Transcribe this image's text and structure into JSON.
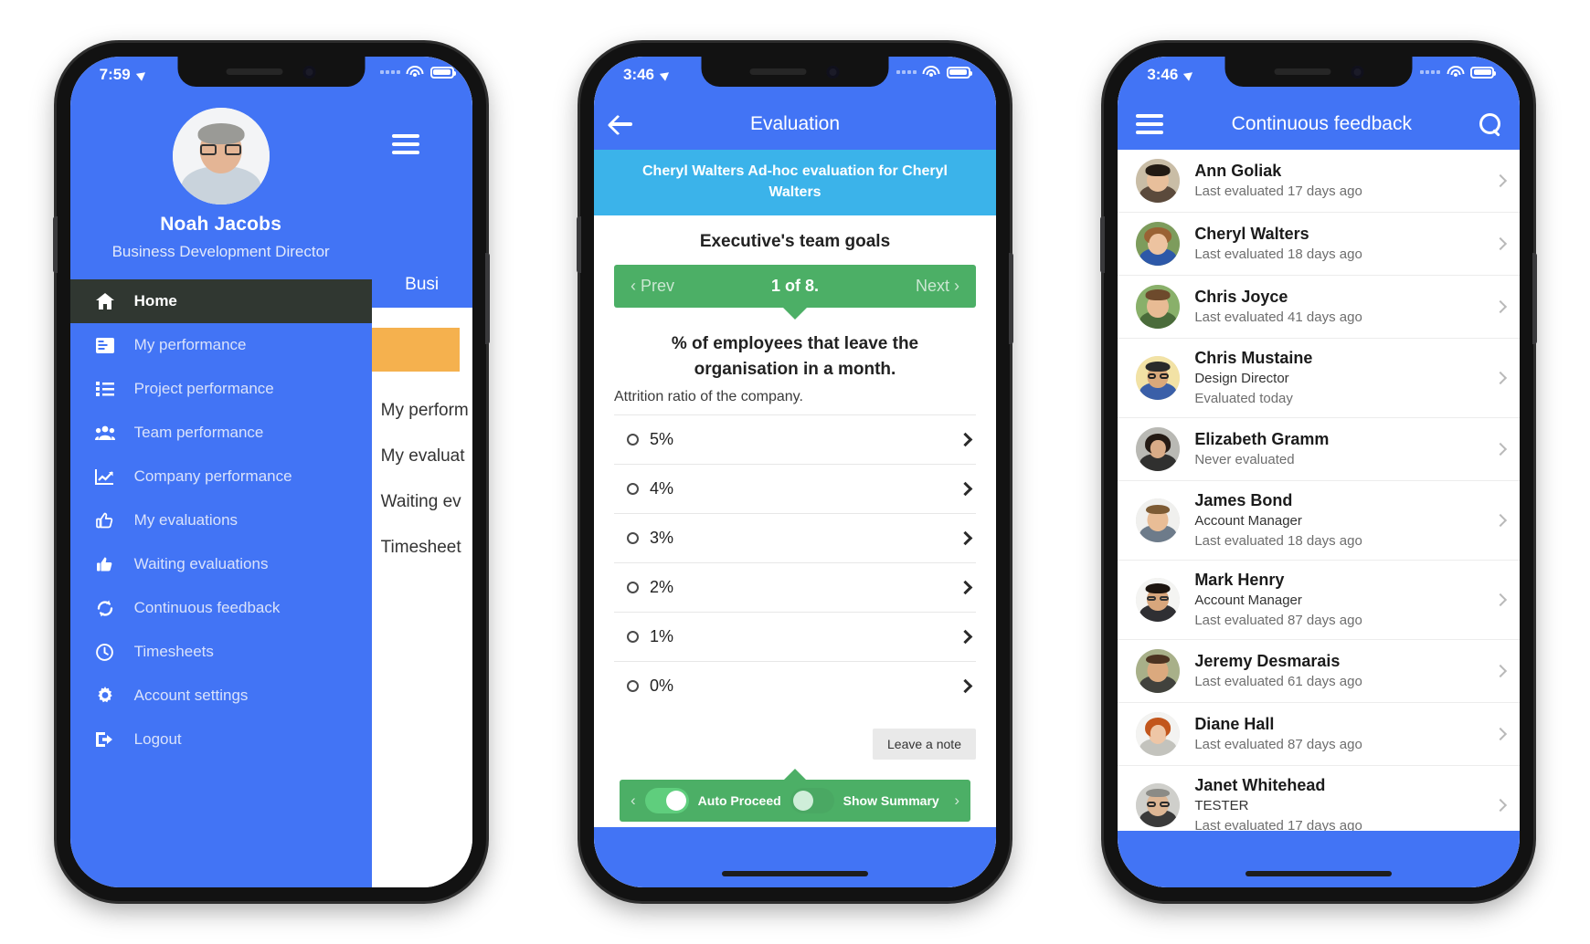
{
  "phone1": {
    "statusbar": {
      "time": "7:59",
      "location_icon": "location-arrow-icon",
      "wifi_icon": "wifi-icon",
      "battery_icon": "battery-icon"
    },
    "profile": {
      "name": "Noah Jacobs",
      "role": "Business Development Director",
      "avatar": "user-avatar"
    },
    "menu": [
      {
        "label": "Home",
        "icon": "home-icon",
        "active": true
      },
      {
        "label": "My performance",
        "icon": "dashboard-icon",
        "active": false
      },
      {
        "label": "Project performance",
        "icon": "list-icon",
        "active": false
      },
      {
        "label": "Team performance",
        "icon": "users-icon",
        "active": false
      },
      {
        "label": "Company performance",
        "icon": "chart-line-icon",
        "active": false
      },
      {
        "label": "My evaluations",
        "icon": "thumbs-up-outline-icon",
        "active": false
      },
      {
        "label": "Waiting evaluations",
        "icon": "thumbs-up-solid-icon",
        "active": false
      },
      {
        "label": "Continuous feedback",
        "icon": "refresh-icon",
        "active": false
      },
      {
        "label": "Timesheets",
        "icon": "clock-icon",
        "active": false
      },
      {
        "label": "Account settings",
        "icon": "gear-icon",
        "active": false
      },
      {
        "label": "Logout",
        "icon": "logout-icon",
        "active": false
      }
    ],
    "underlay": {
      "menu_icon": "hamburger-icon",
      "title": "Busi",
      "links": [
        "My perform",
        "My evaluat",
        "Waiting ev",
        "Timesheet"
      ]
    }
  },
  "phone2": {
    "statusbar": {
      "time": "3:46",
      "location_icon": "location-arrow-icon",
      "wifi_icon": "wifi-icon",
      "battery_icon": "battery-icon"
    },
    "nav": {
      "back_icon": "back-arrow-icon",
      "title": "Evaluation"
    },
    "banner": "Cheryl Walters Ad-hoc evaluation for Cheryl Walters",
    "section_title": "Executive's team goals",
    "pager": {
      "prev": "‹ Prev",
      "current": "1 of 8.",
      "next": "Next ›"
    },
    "question": "% of employees that leave the organisation in a month.",
    "question_sub": "Attrition ratio of the company.",
    "options": [
      "5%",
      "4%",
      "3%",
      "2%",
      "1%",
      "0%"
    ],
    "note_button": "Leave a note",
    "footer_bar": {
      "left_chevron": "‹",
      "right_chevron": "›",
      "toggle1_label": "Auto Proceed",
      "toggle1_state": "on",
      "toggle2_label": "Show Summary",
      "toggle2_state": "off"
    }
  },
  "phone3": {
    "statusbar": {
      "time": "3:46",
      "location_icon": "location-arrow-icon",
      "wifi_icon": "wifi-icon",
      "battery_icon": "battery-icon"
    },
    "nav": {
      "menu_icon": "hamburger-icon",
      "title": "Continuous feedback",
      "search_icon": "search-icon"
    },
    "people": [
      {
        "name": "Ann Goliak",
        "role": "",
        "status": "Last evaluated 17 days ago"
      },
      {
        "name": "Cheryl Walters",
        "role": "",
        "status": "Last evaluated 18 days ago"
      },
      {
        "name": "Chris Joyce",
        "role": "",
        "status": "Last evaluated 41 days ago"
      },
      {
        "name": "Chris Mustaine",
        "role": "Design Director",
        "status": "Evaluated today"
      },
      {
        "name": "Elizabeth Gramm",
        "role": "",
        "status": "Never evaluated"
      },
      {
        "name": "James Bond",
        "role": "Account Manager",
        "status": "Last evaluated 18 days ago"
      },
      {
        "name": "Mark Henry",
        "role": "Account Manager",
        "status": "Last evaluated 87 days ago"
      },
      {
        "name": "Jeremy Desmarais",
        "role": "",
        "status": "Last evaluated 61 days ago"
      },
      {
        "name": "Diane Hall",
        "role": "",
        "status": "Last evaluated 87 days ago"
      },
      {
        "name": "Janet Whitehead",
        "role": "TESTER",
        "status": "Last evaluated 17 days ago"
      }
    ]
  },
  "colors": {
    "brand_blue": "#4274f5",
    "banner_blue": "#3bb3ea",
    "green": "#4caf66",
    "orange": "#f5b14e",
    "active_dark": "#303731"
  }
}
